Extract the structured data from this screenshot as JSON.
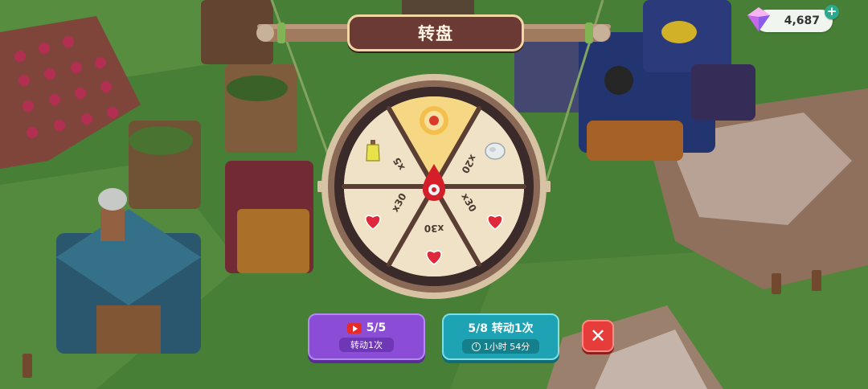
{
  "hud": {
    "gems": {
      "value": "4,687",
      "icon": "gem-icon",
      "plus": "+"
    }
  },
  "dialog": {
    "title": "转盘",
    "wheel": {
      "segments": [
        {
          "label": "",
          "icon": "eye-token-icon",
          "highlighted": true
        },
        {
          "label": "x20",
          "icon": "stone-icon"
        },
        {
          "label": "x30",
          "icon": "heart-icon"
        },
        {
          "label": "x30",
          "icon": "heart-icon"
        },
        {
          "label": "x30",
          "icon": "heart-icon"
        },
        {
          "label": "x5",
          "icon": "potion-bottle-icon"
        }
      ],
      "pointer_icon": "blood-drop-pointer-icon"
    },
    "buttons": {
      "video": {
        "count": "5/5",
        "sub": "转动1次",
        "icon": "video-play-icon",
        "color": "#8b4dd6"
      },
      "spin": {
        "count_label": "5/8 转动1次",
        "timer": "1小时 54分",
        "icon": "clock-icon",
        "color": "#1ea3b4"
      },
      "close": {
        "icon": "close-icon",
        "color": "#e63d3a"
      }
    }
  }
}
